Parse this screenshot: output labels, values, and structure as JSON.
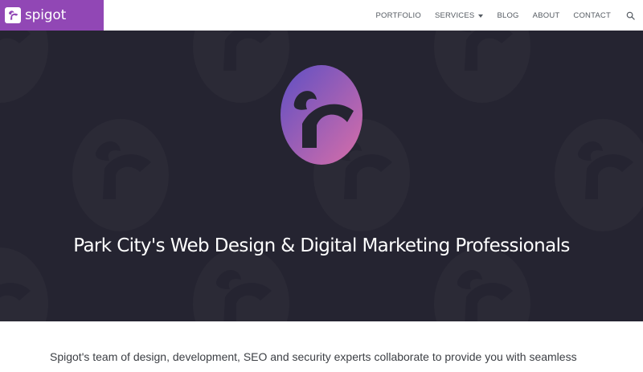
{
  "brand": {
    "name": "spigot",
    "accent": "#9147b5",
    "icon": "spigot-logo-icon"
  },
  "nav": {
    "items": [
      {
        "label": "PORTFOLIO"
      },
      {
        "label": "SERVICES",
        "has_dropdown": true,
        "icon": "caret-down-icon"
      },
      {
        "label": "BLOG"
      },
      {
        "label": "ABOUT"
      },
      {
        "label": "CONTACT"
      }
    ],
    "search_icon": "search-icon"
  },
  "hero": {
    "title": "Park City's Web Design & Digital Marketing Professionals",
    "background": "#252431",
    "logo_icon": "spigot-emblem-icon",
    "gradient": [
      "#6a4fc2",
      "#d06aaa"
    ]
  },
  "intro": {
    "text": "Spigot's team of design, development, SEO and security experts collaborate to provide you with seamless website design, digital marketing and support well as dozens of"
  }
}
